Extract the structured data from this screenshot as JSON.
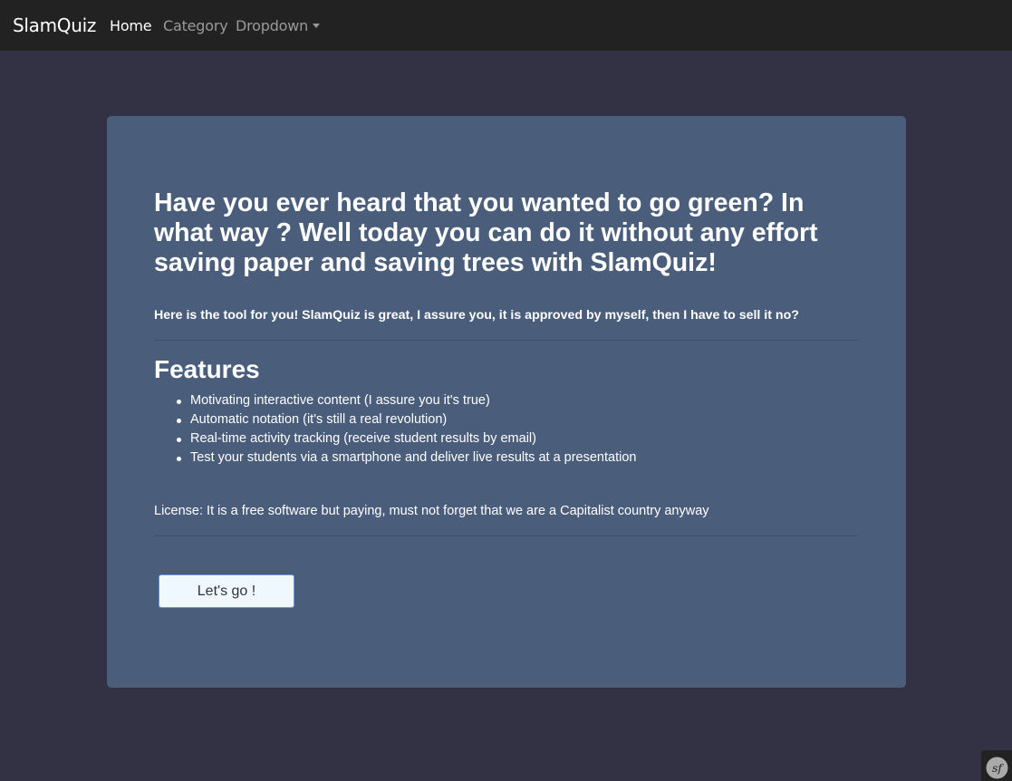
{
  "navbar": {
    "brand": "SlamQuiz",
    "links": [
      {
        "label": "Home",
        "active": true
      },
      {
        "label": "Category",
        "active": false
      },
      {
        "label": "Dropdown",
        "active": false,
        "has_caret": true
      }
    ]
  },
  "jumbotron": {
    "headline": "Have you ever heard that you wanted to go green? In what way ? Well today you can do it without any effort saving paper and saving trees with SlamQuiz!",
    "lead": "Here is the tool for you! SlamQuiz is great, I assure you, it is approved by myself, then I have to sell it no?",
    "features_title": "Features",
    "features": [
      "Motivating interactive content (I assure you it's true)",
      "Automatic notation (it's still a real revolution)",
      "Real-time activity tracking (receive student results by email)",
      "Test your students via a smartphone and deliver live results at a presentation"
    ],
    "license": "License: It is a free software but paying, must not forget that we are a Capitalist country anyway",
    "cta_label": "Let's go !"
  },
  "debug_toolbar": {
    "icon": "symfony-icon",
    "label": "sf"
  },
  "colors": {
    "page_background": "#333244",
    "navbar_background": "#222222",
    "jumbotron_background": "#4a5e7b",
    "button_background": "#f0f8ff",
    "button_border": "#6a9bd6"
  }
}
